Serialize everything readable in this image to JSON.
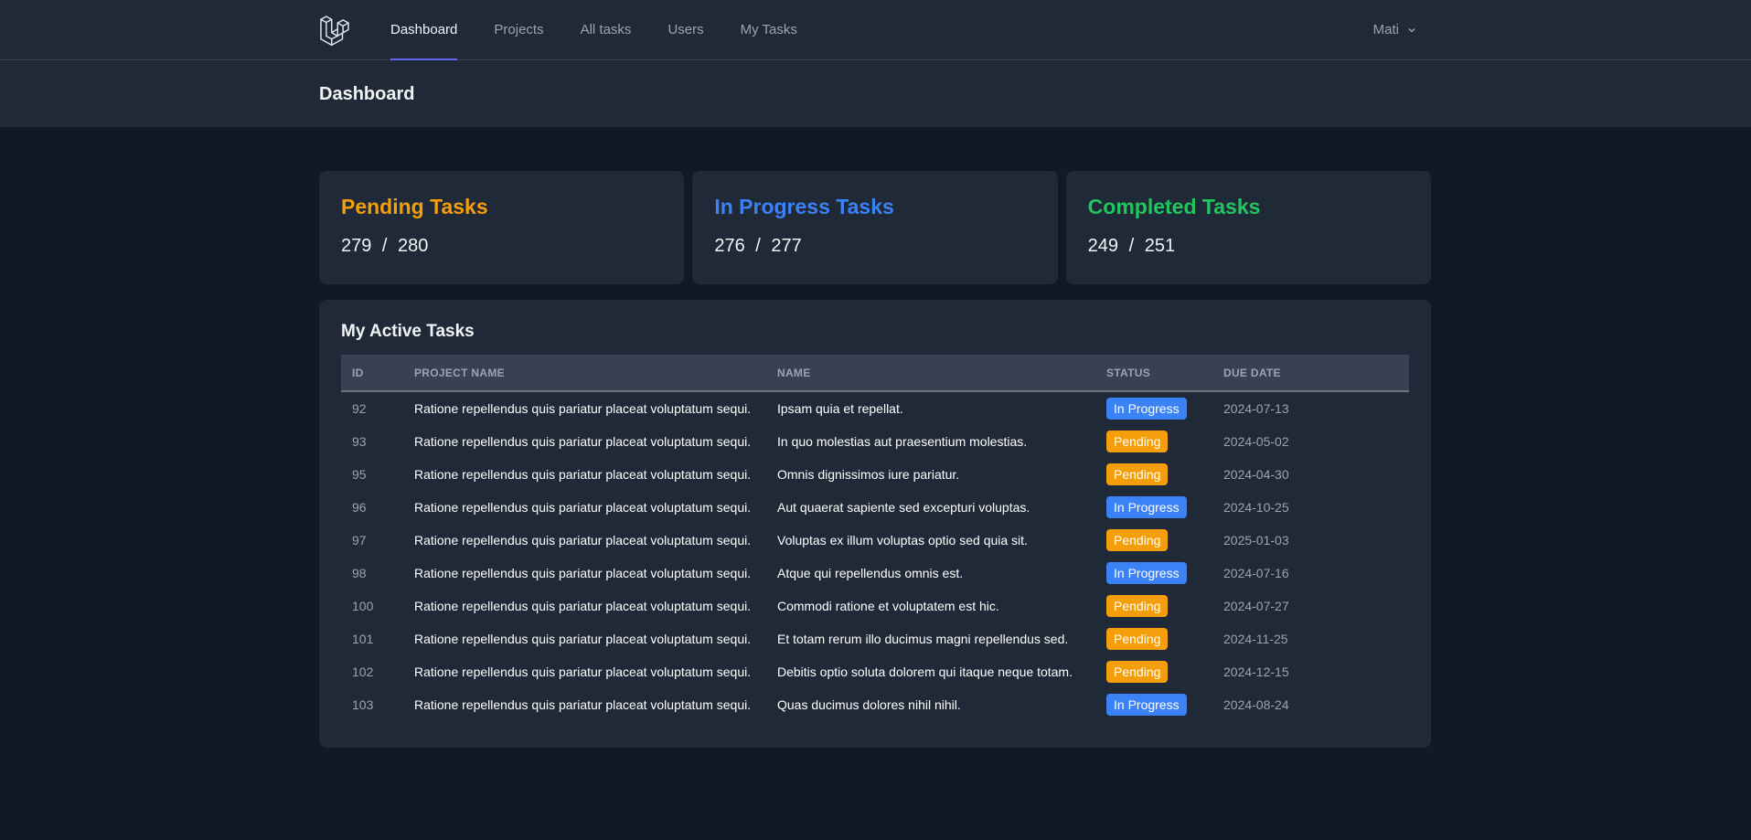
{
  "nav": {
    "items": [
      {
        "label": "Dashboard",
        "active": true
      },
      {
        "label": "Projects",
        "active": false
      },
      {
        "label": "All tasks",
        "active": false
      },
      {
        "label": "Users",
        "active": false
      },
      {
        "label": "My Tasks",
        "active": false
      }
    ],
    "user_name": "Mati"
  },
  "header": {
    "title": "Dashboard"
  },
  "stats": [
    {
      "title": "Pending Tasks",
      "value": "279 / 280",
      "color": "#f59e0b"
    },
    {
      "title": "In Progress Tasks",
      "value": "276 / 277",
      "color": "#3b82f6"
    },
    {
      "title": "Completed Tasks",
      "value": "249 / 251",
      "color": "#22c55e"
    }
  ],
  "active_tasks": {
    "title": "My Active Tasks",
    "columns": [
      "ID",
      "Project Name",
      "Name",
      "Status",
      "Due Date"
    ],
    "rows": [
      {
        "id": "92",
        "project": "Ratione repellendus quis pariatur placeat voluptatum sequi.",
        "name": "Ipsam quia et repellat.",
        "status": "In Progress",
        "due": "2024-07-13"
      },
      {
        "id": "93",
        "project": "Ratione repellendus quis pariatur placeat voluptatum sequi.",
        "name": "In quo molestias aut praesentium molestias.",
        "status": "Pending",
        "due": "2024-05-02"
      },
      {
        "id": "95",
        "project": "Ratione repellendus quis pariatur placeat voluptatum sequi.",
        "name": "Omnis dignissimos iure pariatur.",
        "status": "Pending",
        "due": "2024-04-30"
      },
      {
        "id": "96",
        "project": "Ratione repellendus quis pariatur placeat voluptatum sequi.",
        "name": "Aut quaerat sapiente sed excepturi voluptas.",
        "status": "In Progress",
        "due": "2024-10-25"
      },
      {
        "id": "97",
        "project": "Ratione repellendus quis pariatur placeat voluptatum sequi.",
        "name": "Voluptas ex illum voluptas optio sed quia sit.",
        "status": "Pending",
        "due": "2025-01-03"
      },
      {
        "id": "98",
        "project": "Ratione repellendus quis pariatur placeat voluptatum sequi.",
        "name": "Atque qui repellendus omnis est.",
        "status": "In Progress",
        "due": "2024-07-16"
      },
      {
        "id": "100",
        "project": "Ratione repellendus quis pariatur placeat voluptatum sequi.",
        "name": "Commodi ratione et voluptatem est hic.",
        "status": "Pending",
        "due": "2024-07-27"
      },
      {
        "id": "101",
        "project": "Ratione repellendus quis pariatur placeat voluptatum sequi.",
        "name": "Et totam rerum illo ducimus magni repellendus sed.",
        "status": "Pending",
        "due": "2024-11-25"
      },
      {
        "id": "102",
        "project": "Ratione repellendus quis pariatur placeat voluptatum sequi.",
        "name": "Debitis optio soluta dolorem qui itaque neque totam.",
        "status": "Pending",
        "due": "2024-12-15"
      },
      {
        "id": "103",
        "project": "Ratione repellendus quis pariatur placeat voluptatum sequi.",
        "name": "Quas ducimus dolores nihil nihil.",
        "status": "In Progress",
        "due": "2024-08-24"
      }
    ]
  },
  "icons": {
    "logo": "laravel-logo-icon",
    "user_menu": "chevron-down-icon"
  }
}
